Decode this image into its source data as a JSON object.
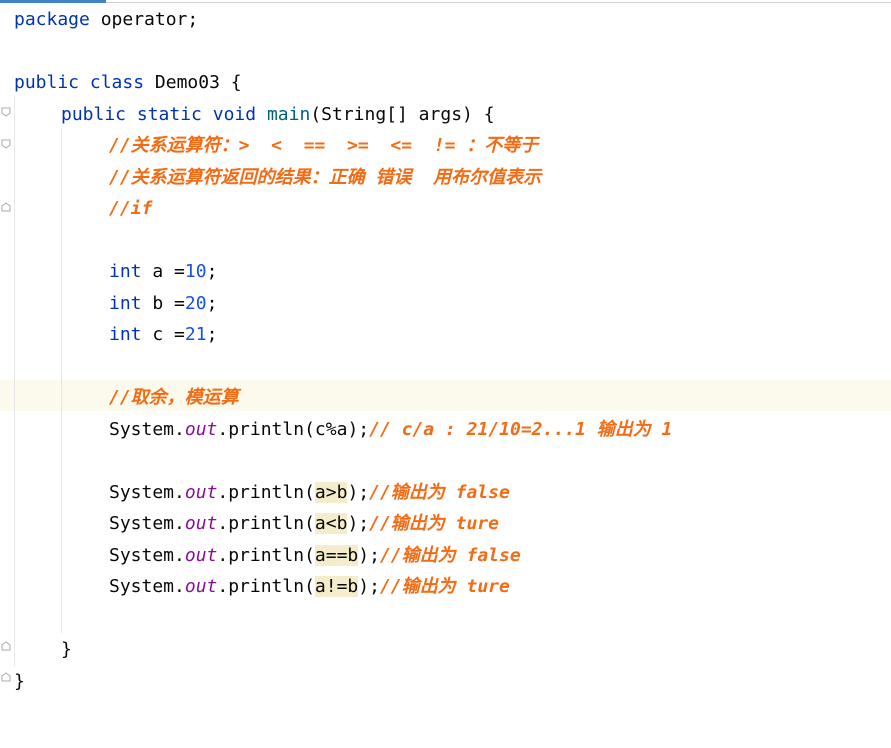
{
  "editor": {
    "lines": [
      {
        "kind": "pkg",
        "kw": "package",
        "rest": " operator;"
      },
      {
        "kind": "blank"
      },
      {
        "kind": "cls",
        "kw1": "public",
        "kw2": "class",
        "rest": " Demo03 {"
      },
      {
        "kind": "main",
        "kw1": "public",
        "kw2": "static",
        "kw3": "void",
        "name": "main",
        "rest": "(String[] args) {"
      },
      {
        "kind": "comment",
        "text": "//关系运算符：>  <  ==  >=  <=  != ：不等于"
      },
      {
        "kind": "comment",
        "text": "//关系运算符返回的结果：正确 错误  用布尔值表示"
      },
      {
        "kind": "comment",
        "text": "//if"
      },
      {
        "kind": "blank"
      },
      {
        "kind": "decl",
        "type": "int",
        "name": " a =",
        "value": "10",
        "end": ";"
      },
      {
        "kind": "decl",
        "type": "int",
        "name": " b =",
        "value": "20",
        "end": ";"
      },
      {
        "kind": "decl",
        "type": "int",
        "name": " c =",
        "value": "21",
        "end": ";"
      },
      {
        "kind": "blank"
      },
      {
        "kind": "comment",
        "text": "//取余，模运算"
      },
      {
        "kind": "print",
        "pre": "System.",
        "field": "out",
        "call": ".println(",
        "arg": "c%a",
        "post": ");",
        "comment": "// c/a : 21/10=2...1 输出为 1"
      },
      {
        "kind": "blank"
      },
      {
        "kind": "print",
        "pre": "System.",
        "field": "out",
        "call": ".println(",
        "arg": "a>b",
        "post": ");",
        "comment": "//输出为 false"
      },
      {
        "kind": "print",
        "pre": "System.",
        "field": "out",
        "call": ".println(",
        "arg": "a<b",
        "post": ");",
        "comment": "//输出为 ture"
      },
      {
        "kind": "print",
        "pre": "System.",
        "field": "out",
        "call": ".println(",
        "arg": "a==b",
        "post": ");",
        "comment": "//输出为 false"
      },
      {
        "kind": "print",
        "pre": "System.",
        "field": "out",
        "call": ".println(",
        "arg": "a!=b",
        "post": ");",
        "comment": "//输出为 ture"
      },
      {
        "kind": "blank"
      },
      {
        "kind": "close",
        "text": "}"
      },
      {
        "kind": "close",
        "text": "}"
      }
    ]
  },
  "colors": {
    "keyword": "#0033b3",
    "number": "#1750eb",
    "comment": "#f26b15",
    "field": "#871094",
    "current_line": "#fcfaed",
    "match_highlight": "#f5eccb"
  }
}
